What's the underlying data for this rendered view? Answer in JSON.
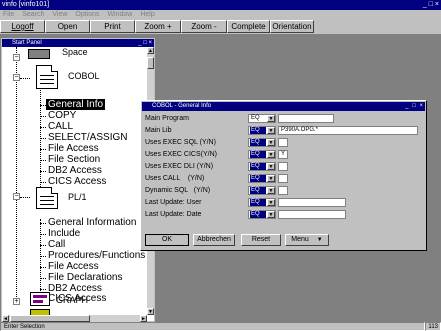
{
  "app": {
    "title": "vinfo [vinfo101]",
    "window_controls": "_ □ ×"
  },
  "menubar": {
    "items": [
      "File",
      "Search",
      "View",
      "Options",
      "Window",
      "Help"
    ]
  },
  "toolbar": {
    "buttons": [
      "Logoff",
      "Open",
      "Print",
      "Zoom +",
      "Zoom -",
      "Complete",
      "Orientation"
    ]
  },
  "tree_window": {
    "title": "Start Panel",
    "controls": "_ □ ×",
    "items": {
      "space": "Space",
      "cobol": "COBOL",
      "general_info": "General Info",
      "copy": "COPY",
      "call": "CALL",
      "select_assign": "SELECT/ASSIGN",
      "file_access": "File Access",
      "file_section": "File Section",
      "db2_access": "DB2 Access",
      "cics_access": "CICS Access",
      "pl1": "PL/1",
      "pl1_general_information": "General Information",
      "pl1_include": "Include",
      "pl1_call": "Call",
      "pl1_procedures": "Procedures/Functions",
      "pl1_file_access": "File Access",
      "pl1_file_declarations": "File Declarations",
      "pl1_db2_access": "DB2 Access",
      "pl1_cics_access": "CICS Access",
      "graph": "GRAPH"
    },
    "scroll_up": "▲",
    "scroll_down": "▼",
    "scroll_left": "◄",
    "scroll_right": "►"
  },
  "dialog": {
    "title": "COBOL - General Info",
    "controls": "_ □ ×",
    "combo_arrow": "▼",
    "fields": [
      {
        "label": "Main Program",
        "op": "EQ",
        "value": ""
      },
      {
        "label": "Main Lib",
        "op": "EQ",
        "value": "P390A.OPG.*"
      },
      {
        "label": "Uses EXEC SQL (Y/N)",
        "op": "EQ",
        "value": ""
      },
      {
        "label": "Uses EXEC CICS(Y/N)",
        "op": "EQ",
        "value": "Y"
      },
      {
        "label": "Uses EXEC DLI (Y/N)",
        "op": "EQ",
        "value": ""
      },
      {
        "label": "Uses CALL    (Y/N)",
        "op": "EQ",
        "value": ""
      },
      {
        "label": "Dynamic SQL   (Y/N)",
        "op": "EQ",
        "value": ""
      },
      {
        "label": "Last Update: User",
        "op": "EQ",
        "value": ""
      },
      {
        "label": "Last Update: Date",
        "op": "EQ",
        "value": ""
      }
    ],
    "buttons": {
      "ok": "OK",
      "abbrechen": "Abbrechen",
      "reset": "Reset",
      "menu": "Menu",
      "menu_arrow": "▼"
    }
  },
  "statusbar": {
    "text": "Enter Selection",
    "number": "113"
  }
}
